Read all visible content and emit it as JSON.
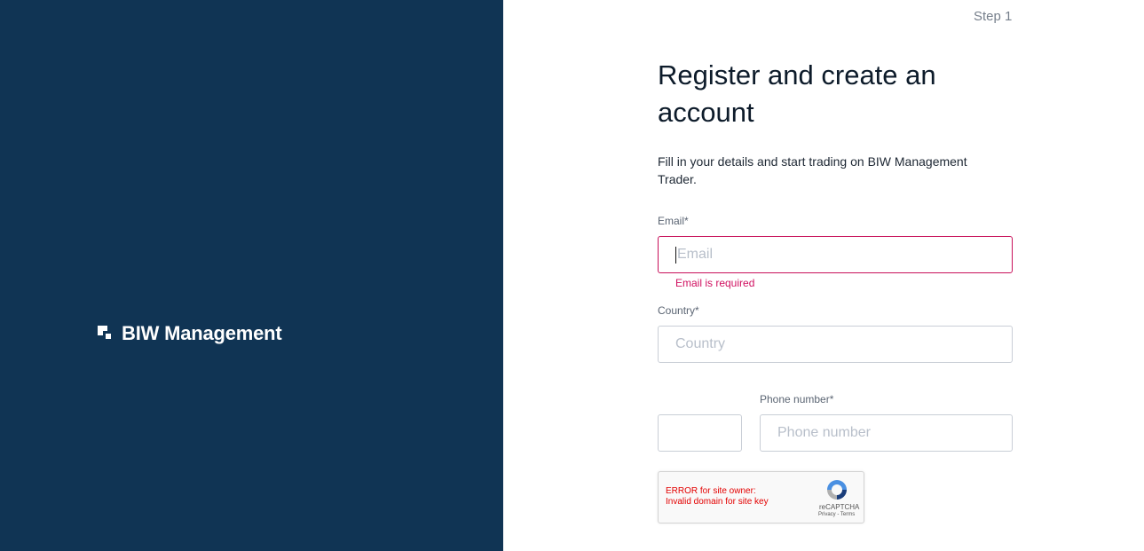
{
  "brand": {
    "name": "BIW Management"
  },
  "header": {
    "step": "Step 1"
  },
  "form": {
    "title": "Register and create an account",
    "subtitle": "Fill in your details and start trading on BIW Management Trader.",
    "email": {
      "label": "Email*",
      "placeholder": "Email",
      "value": "",
      "error": "Email is required"
    },
    "country": {
      "label": "Country*",
      "placeholder": "Country",
      "value": ""
    },
    "phone_code": {
      "value": ""
    },
    "phone": {
      "label": "Phone number*",
      "placeholder": "Phone number",
      "value": ""
    }
  },
  "recaptcha": {
    "error_line1": "ERROR for site owner:",
    "error_line2": "Invalid domain for site key",
    "brand": "reCAPTCHA",
    "links": "Privacy - Terms"
  },
  "colors": {
    "panel_bg": "#103454",
    "error": "#c8105a",
    "captcha_error": "#e30000"
  }
}
